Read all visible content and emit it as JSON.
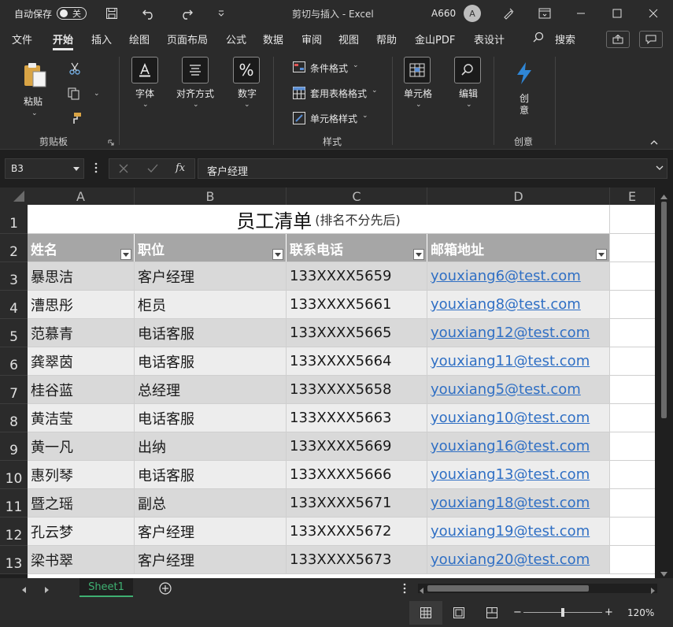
{
  "titlebar": {
    "autosave_label": "自动保存",
    "autosave_state": "关",
    "doc_title": "剪切与插入 - Excel",
    "user_name": "A660",
    "avatar_letter": "A"
  },
  "menu": {
    "tabs": [
      "文件",
      "开始",
      "插入",
      "绘图",
      "页面布局",
      "公式",
      "数据",
      "审阅",
      "视图",
      "帮助",
      "金山PDF",
      "表设计"
    ],
    "active_index": 1,
    "search_label": "搜索"
  },
  "ribbon": {
    "paste": "粘贴",
    "clipboard_group": "剪贴板",
    "font": "字体",
    "align": "对齐方式",
    "number": "数字",
    "cond_format": "条件格式",
    "table_format": "套用表格格式",
    "cell_style": "单元格样式",
    "styles_group": "样式",
    "cells": "单元格",
    "edit": "编辑",
    "creative_top": "创",
    "creative_bottom": "意",
    "creative_group": "创意"
  },
  "formula_bar": {
    "name_box": "B3",
    "fx": "fx",
    "formula": "客户经理"
  },
  "grid": {
    "columns": [
      "A",
      "B",
      "C",
      "D",
      "E"
    ],
    "row_numbers": [
      "1",
      "2",
      "3",
      "4",
      "5",
      "6",
      "7",
      "8",
      "9",
      "10",
      "11",
      "12",
      "13"
    ],
    "title_main": "员工清单",
    "title_note": "(排名不分先后)",
    "headers": [
      "姓名",
      "职位",
      "联系电话",
      "邮箱地址"
    ],
    "rows": [
      [
        "暴思洁",
        "客户经理",
        "133XXXX5659",
        "youxiang6@test.com"
      ],
      [
        "漕思彤",
        "柜员",
        "133XXXX5661",
        "youxiang8@test.com"
      ],
      [
        "范慕青",
        "电话客服",
        "133XXXX5665",
        "youxiang12@test.com"
      ],
      [
        "龚翠茵",
        "电话客服",
        "133XXXX5664",
        "youxiang11@test.com"
      ],
      [
        "桂谷蓝",
        "总经理",
        "133XXXX5658",
        "youxiang5@test.com"
      ],
      [
        "黄洁莹",
        "电话客服",
        "133XXXX5663",
        "youxiang10@test.com"
      ],
      [
        "黄一凡",
        "出纳",
        "133XXXX5669",
        "youxiang16@test.com"
      ],
      [
        "惠列琴",
        "电话客服",
        "133XXXX5666",
        "youxiang13@test.com"
      ],
      [
        "暨之瑶",
        "副总",
        "133XXXX5671",
        "youxiang18@test.com"
      ],
      [
        "孔云梦",
        "客户经理",
        "133XXXX5672",
        "youxiang19@test.com"
      ],
      [
        "梁书翠",
        "客户经理",
        "133XXXX5673",
        "youxiang20@test.com"
      ]
    ]
  },
  "sheets": {
    "tabs": [
      "Sheet1"
    ]
  },
  "status": {
    "zoom": "120%",
    "zoom_fraction": 0.5
  },
  "colors": {
    "accent_green": "#3fb072",
    "header_fill": "#a6a6a6",
    "band_dark": "#d9d9d9",
    "band_light": "#ededed",
    "link": "#2f6fc4"
  }
}
